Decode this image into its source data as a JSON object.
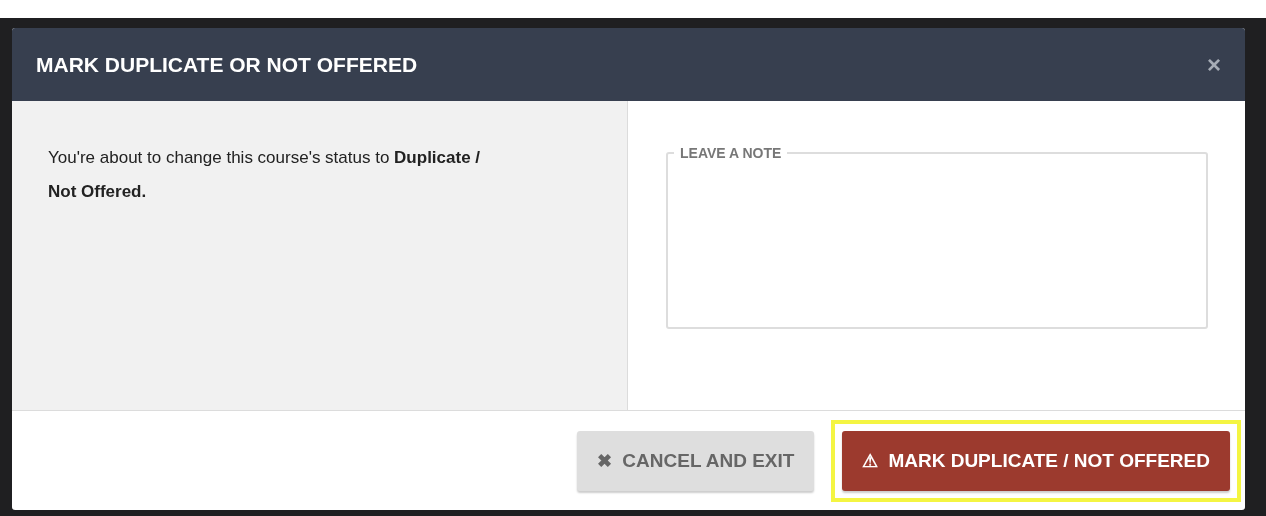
{
  "dialog": {
    "title": "MARK DUPLICATE OR NOT OFFERED",
    "close": "×"
  },
  "message": "You're about to change this course's status to **Duplicate / Not Offered.**",
  "note": {
    "label": "LEAVE A NOTE"
  },
  "buttons": [
    {
      "kind": "secondary",
      "icon": "✖",
      "label": "CANCEL AND EXIT",
      "highlighted": false
    },
    {
      "kind": "primary",
      "icon": "⚠",
      "label": "MARK DUPLICATE / NOT OFFERED",
      "highlighted": true
    }
  ]
}
